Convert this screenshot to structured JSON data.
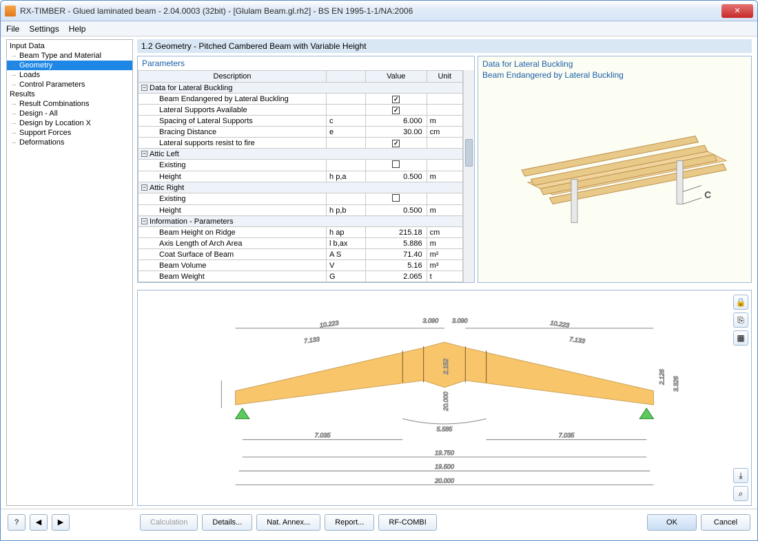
{
  "window": {
    "title": "RX-TIMBER - Glued laminated beam - 2.04.0003 (32bit) - [Glulam Beam.gl.rh2] - BS EN 1995-1-1/NA:2006"
  },
  "menu": {
    "file": "File",
    "settings": "Settings",
    "help": "Help"
  },
  "tree": {
    "input": "Input Data",
    "beam_type": "Beam Type and Material",
    "geometry": "Geometry",
    "loads": "Loads",
    "control": "Control Parameters",
    "results": "Results",
    "result_comb": "Result Combinations",
    "design_all": "Design - All",
    "design_loc": "Design by Location X",
    "support": "Support Forces",
    "deform": "Deformations"
  },
  "header": {
    "title": "1.2 Geometry  -  Pitched Cambered Beam with Variable Height"
  },
  "params": {
    "title": "Parameters",
    "col_desc": "Description",
    "col_value": "Value",
    "col_unit": "Unit",
    "groups": {
      "lateral": "Data for Lateral Buckling",
      "attic_left": "Attic Left",
      "attic_right": "Attic Right",
      "info": "Information - Parameters"
    },
    "rows": {
      "endan": "Beam Endangered by Lateral Buckling",
      "supports_avail": "Lateral Supports Available",
      "spacing": "Spacing of Lateral Supports",
      "spacing_sym": "c",
      "spacing_val": "6.000",
      "spacing_unit": "m",
      "bracing": "Bracing Distance",
      "bracing_sym": "e",
      "bracing_val": "30.00",
      "bracing_unit": "cm",
      "resist_fire": "Lateral supports resist to fire",
      "existing_l": "Existing",
      "height_l": "Height",
      "height_l_sym": "h p,a",
      "height_l_val": "0.500",
      "height_l_unit": "m",
      "existing_r": "Existing",
      "height_r": "Height",
      "height_r_sym": "h p,b",
      "height_r_val": "0.500",
      "height_r_unit": "m",
      "ridge": "Beam Height on Ridge",
      "ridge_sym": "h ap",
      "ridge_val": "215.18",
      "ridge_unit": "cm",
      "arch": "Axis Length of Arch Area",
      "arch_sym": "l b,ax",
      "arch_val": "5.886",
      "arch_unit": "m",
      "coat": "Coat Surface of Beam",
      "coat_sym": "A S",
      "coat_val": "71.40",
      "coat_unit": "m²",
      "vol": "Beam Volume",
      "vol_sym": "V",
      "vol_val": "5.16",
      "vol_unit": "m³",
      "weight": "Beam Weight",
      "weight_sym": "G",
      "weight_val": "2.065",
      "weight_unit": "t"
    }
  },
  "info": {
    "line1": "Data for Lateral Buckling",
    "line2": "Beam Endangered by Lateral Buckling"
  },
  "diagram": {
    "d1": "10.223",
    "d2": "3.090",
    "d3": "3.090",
    "d4": "10.223",
    "d5": "7.133",
    "d6": "7.133",
    "h1": "2.152",
    "h2": "2.126",
    "h3": "3.326",
    "r_arc": "20.000",
    "arc": "5.585",
    "b1": "7.035",
    "b2": "7.035",
    "tot1": "19.750",
    "tot2": "19.500",
    "tot3": "20.000",
    "info_c": "C"
  },
  "footer": {
    "calc": "Calculation",
    "details": "Details...",
    "nat": "Nat. Annex...",
    "report": "Report...",
    "rfcombi": "RF-COMBI",
    "ok": "OK",
    "cancel": "Cancel"
  }
}
